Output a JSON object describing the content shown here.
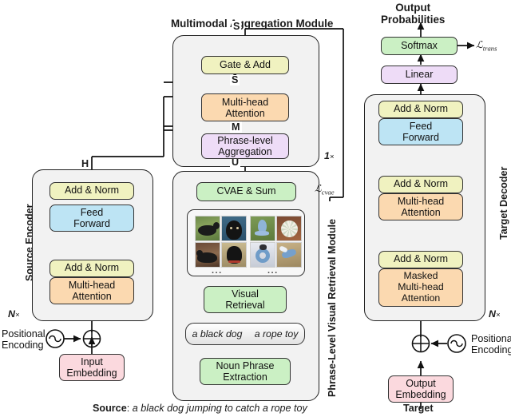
{
  "figure": {
    "titles": {
      "aggregation_module": "Multimodal Aggregation Module",
      "output_probabilities": "Output\nProbabilities"
    },
    "vertical_labels": {
      "source_encoder": "Source Encoder",
      "retrieval_module": "Phrase-Level Visual Retrieval Module",
      "target_decoder": "Target Decoder"
    }
  },
  "source_encoder": {
    "repeat": "N",
    "repeat_suffix": "×",
    "boxes": [
      {
        "label": "Add & Norm",
        "color": "#f0f2c0"
      },
      {
        "label": "Feed\nForward",
        "color": "#bde4f4"
      },
      {
        "label": "Add & Norm",
        "color": "#f0f2c0"
      },
      {
        "label": "Multi-head\nAttention",
        "color": "#fbd9b0"
      }
    ],
    "output_var": "H",
    "positional_encoding": "Positional\nEncoding",
    "embedding": {
      "label": "Input\nEmbedding",
      "color": "#fbd9de"
    }
  },
  "aggregation_module": {
    "repeat": "1",
    "repeat_suffix": "×",
    "boxes": [
      {
        "label": "Gate & Add",
        "color": "#f0f2c0"
      },
      {
        "label": "Multi-head\nAttention",
        "color": "#fbd9b0"
      },
      {
        "label": "Phrase-level\nAggregation",
        "color": "#eedcf7"
      }
    ],
    "vars": {
      "top": "S",
      "mid_bar": "S̄",
      "m": "M",
      "u": "U"
    }
  },
  "retrieval_module": {
    "cvae": {
      "label": "CVAE & Sum",
      "color": "#cbf0c4"
    },
    "cvae_loss": "L_cvae",
    "visual_retrieval": {
      "label": "Visual\nRetrieval",
      "color": "#cbf0c4"
    },
    "noun_phrase": {
      "label": "Noun Phrase\nExtraction",
      "color": "#cbf0c4"
    },
    "phrases": [
      "a black dog",
      "a rope toy"
    ],
    "grid_ellipsis": "...",
    "image_groups": [
      {
        "phrase": "a black dog",
        "thumbs": [
          "black-dog-grass",
          "black-dog-closeup",
          "black-dog-lying",
          "black-dog-portrait"
        ]
      },
      {
        "phrase": "a rope toy",
        "thumbs": [
          "blue-rope-toy-grass",
          "white-rope-ball",
          "blue-rope-ring",
          "blue-rope-knot"
        ]
      }
    ]
  },
  "target_decoder": {
    "repeat": "N",
    "repeat_suffix": "×",
    "softmax": {
      "label": "Softmax",
      "color": "#cbf0c4"
    },
    "trans_loss": "L_trans",
    "linear": {
      "label": "Linear",
      "color": "#eedcf7"
    },
    "boxes": [
      {
        "label": "Add & Norm",
        "color": "#f0f2c0"
      },
      {
        "label": "Feed\nForward",
        "color": "#bde4f4"
      },
      {
        "label": "Add & Norm",
        "color": "#f0f2c0"
      },
      {
        "label": "Multi-head\nAttention",
        "color": "#fbd9b0"
      },
      {
        "label": "Add & Norm",
        "color": "#f0f2c0"
      },
      {
        "label": "Masked\nMulti-head\nAttention",
        "color": "#fbd9b0"
      }
    ],
    "positional_encoding": "Positional\nEncoding",
    "embedding": {
      "label": "Output\nEmbedding",
      "color": "#fbd9de"
    }
  },
  "captions": {
    "source_prefix": "Source",
    "source_colon": ": ",
    "source_text": "a black dog jumping to catch a rope toy",
    "target": "Target"
  },
  "colors": {
    "panel_bg": "#f2f2f2",
    "stroke": "#222222",
    "yellow": "#f0f2c0",
    "blue": "#bde4f4",
    "orange": "#fbd9b0",
    "purple": "#eedcf7",
    "green": "#cbf0c4",
    "pink": "#fbd9de"
  }
}
